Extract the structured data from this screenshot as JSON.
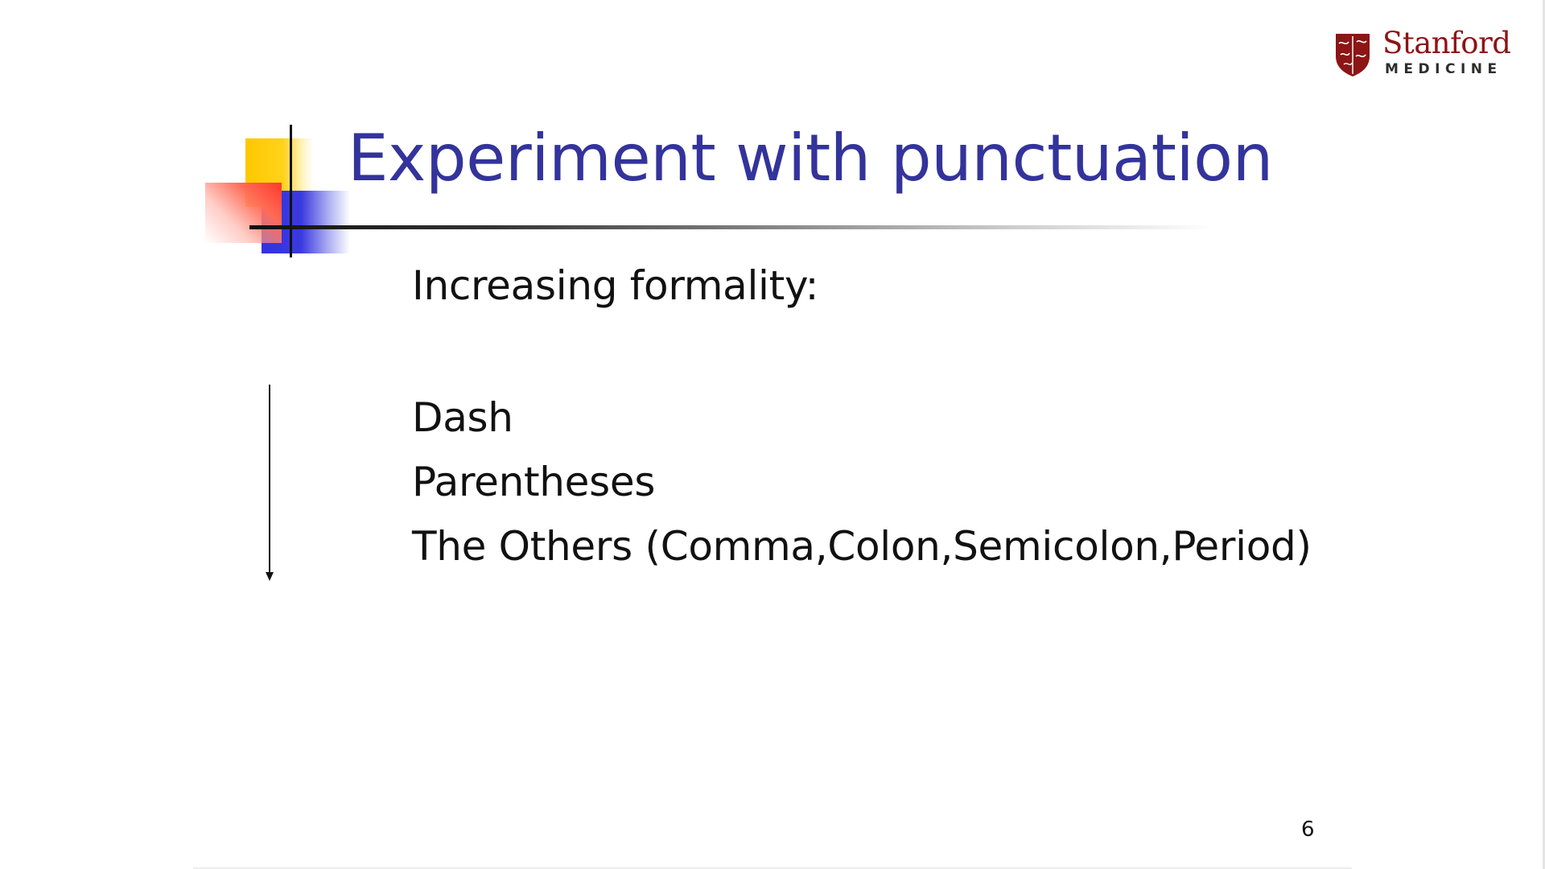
{
  "logo": {
    "wordmark": "Stanford",
    "subtitle": "MEDICINE",
    "colors": {
      "brand": "#8c1515",
      "sub": "#2e2d29"
    },
    "icon": "shield-icon"
  },
  "slide": {
    "title": "Experiment with punctuation",
    "intro": "Increasing formality:",
    "items": [
      "Dash",
      "Parentheses",
      "The Others (Comma,Colon,Semicolon,Period)"
    ],
    "page_number": "6",
    "colors": {
      "title": "#33339c",
      "text": "#111111",
      "accent_yellow": "#ffc800",
      "accent_blue": "#3333dd",
      "accent_red": "#ff3a2a"
    },
    "arrow_icon": "down-arrow-icon"
  }
}
